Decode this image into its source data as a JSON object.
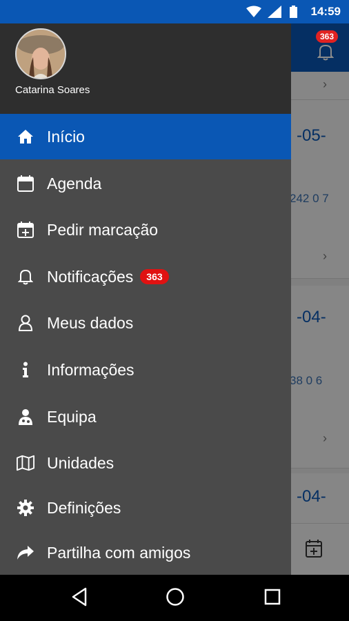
{
  "status_bar": {
    "time": "14:59",
    "icons": [
      "wifi-icon",
      "signal-icon",
      "battery-icon"
    ]
  },
  "background_app": {
    "notification_badge": "363",
    "cards": [
      {
        "date": "-05-",
        "number": "242 0 7"
      },
      {
        "date": "-04-",
        "number": "38 0 6"
      },
      {
        "date": "-04-",
        "number": ""
      }
    ]
  },
  "drawer": {
    "user_name": "Catarina Soares",
    "items": [
      {
        "label": "Início",
        "icon": "home-icon",
        "active": true
      },
      {
        "label": "Agenda",
        "icon": "calendar-icon"
      },
      {
        "label": "Pedir marcação",
        "icon": "calendar-add-icon"
      },
      {
        "label": "Notificações",
        "icon": "bell-icon",
        "badge": "363"
      },
      {
        "label": "Meus dados",
        "icon": "user-icon"
      },
      {
        "label": "Informações",
        "icon": "info-icon"
      },
      {
        "label": "Equipa",
        "icon": "doctor-icon"
      },
      {
        "label": "Unidades",
        "icon": "map-icon"
      },
      {
        "label": "Definições",
        "icon": "gear-icon"
      },
      {
        "label": "Partilha com amigos",
        "icon": "share-icon"
      }
    ]
  },
  "nav_bar": [
    "back-icon",
    "home-circle-icon",
    "recents-icon"
  ],
  "colors": {
    "primary": "#0a57b4",
    "drawer_bg": "#4a4a4a",
    "drawer_header": "#2e2e2e",
    "badge": "#e01212"
  }
}
